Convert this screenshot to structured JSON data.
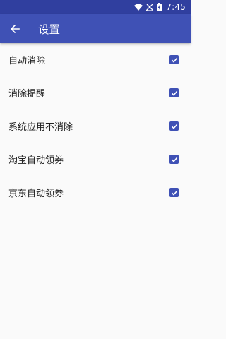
{
  "status_bar": {
    "time": "7:45",
    "icons": [
      "wifi-icon",
      "no-signal-icon",
      "battery-charging-icon"
    ]
  },
  "app_bar": {
    "title": "设置",
    "back_icon": "arrow-left-icon",
    "color": "#3f51b5",
    "status_color": "#303f9f"
  },
  "settings": [
    {
      "label": "自动消除",
      "checked": true
    },
    {
      "label": "消除提醒",
      "checked": true
    },
    {
      "label": "系统应用不消除",
      "checked": true
    },
    {
      "label": "淘宝自动领券",
      "checked": true
    },
    {
      "label": "京东自动领券",
      "checked": true
    }
  ]
}
